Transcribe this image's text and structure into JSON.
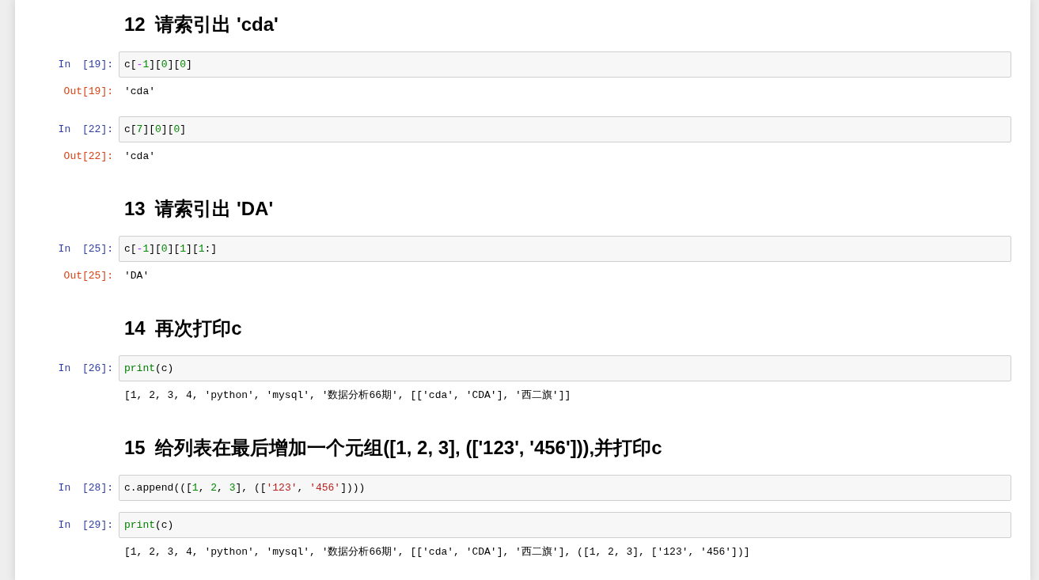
{
  "notebook": {
    "cells": [
      {
        "kind": "markdown",
        "number": "12",
        "title": "请索引出 'cda'"
      },
      {
        "kind": "code",
        "prompt": "In [19]:",
        "code": [
          {
            "text": "c[",
            "kind": "name"
          },
          {
            "text": "-",
            "kind": "operator"
          },
          {
            "text": "1",
            "kind": "number"
          },
          {
            "text": "][",
            "kind": "name"
          },
          {
            "text": "0",
            "kind": "number"
          },
          {
            "text": "][",
            "kind": "name"
          },
          {
            "text": "0",
            "kind": "number"
          },
          {
            "text": "]",
            "kind": "name"
          }
        ],
        "output": {
          "kind": "result",
          "prompt": "Out[19]:",
          "text": "'cda'"
        }
      },
      {
        "kind": "code",
        "prompt": "In [22]:",
        "code": [
          {
            "text": "c[",
            "kind": "name"
          },
          {
            "text": "7",
            "kind": "number"
          },
          {
            "text": "][",
            "kind": "name"
          },
          {
            "text": "0",
            "kind": "number"
          },
          {
            "text": "][",
            "kind": "name"
          },
          {
            "text": "0",
            "kind": "number"
          },
          {
            "text": "]",
            "kind": "name"
          }
        ],
        "output": {
          "kind": "result",
          "prompt": "Out[22]:",
          "text": "'cda'"
        }
      },
      {
        "kind": "markdown",
        "number": "13",
        "title": "请索引出 'DA'"
      },
      {
        "kind": "code",
        "prompt": "In [25]:",
        "code": [
          {
            "text": "c[",
            "kind": "name"
          },
          {
            "text": "-",
            "kind": "operator"
          },
          {
            "text": "1",
            "kind": "number"
          },
          {
            "text": "][",
            "kind": "name"
          },
          {
            "text": "0",
            "kind": "number"
          },
          {
            "text": "][",
            "kind": "name"
          },
          {
            "text": "1",
            "kind": "number"
          },
          {
            "text": "][",
            "kind": "name"
          },
          {
            "text": "1",
            "kind": "number"
          },
          {
            "text": ":]",
            "kind": "name"
          }
        ],
        "output": {
          "kind": "result",
          "prompt": "Out[25]:",
          "text": "'DA'"
        }
      },
      {
        "kind": "markdown",
        "number": "14",
        "title": "再次打印c"
      },
      {
        "kind": "code",
        "prompt": "In [26]:",
        "code": [
          {
            "text": "print",
            "kind": "builtin"
          },
          {
            "text": "(c)",
            "kind": "name"
          }
        ],
        "output": {
          "kind": "stream",
          "text": "[1, 2, 3, 4, 'python', 'mysql', '数据分析66期', [['cda', 'CDA'], '西二旗']]"
        }
      },
      {
        "kind": "markdown",
        "number": "15",
        "title": "给列表在最后增加一个元组([1, 2, 3], (['123', '456'])),并打印c"
      },
      {
        "kind": "code",
        "prompt": "In [28]:",
        "code": [
          {
            "text": "c.append(([",
            "kind": "name"
          },
          {
            "text": "1",
            "kind": "number"
          },
          {
            "text": ", ",
            "kind": "name"
          },
          {
            "text": "2",
            "kind": "number"
          },
          {
            "text": ", ",
            "kind": "name"
          },
          {
            "text": "3",
            "kind": "number"
          },
          {
            "text": "], ([",
            "kind": "name"
          },
          {
            "text": "'123'",
            "kind": "string"
          },
          {
            "text": ", ",
            "kind": "name"
          },
          {
            "text": "'456'",
            "kind": "string"
          },
          {
            "text": "])))",
            "kind": "name"
          }
        ]
      },
      {
        "kind": "code",
        "prompt": "In [29]:",
        "code": [
          {
            "text": "print",
            "kind": "builtin"
          },
          {
            "text": "(c)",
            "kind": "name"
          }
        ],
        "output": {
          "kind": "stream",
          "text": "[1, 2, 3, 4, 'python', 'mysql', '数据分析66期', [['cda', 'CDA'], '西二旗'], ([1, 2, 3], ['123', '456'])]"
        }
      }
    ]
  }
}
